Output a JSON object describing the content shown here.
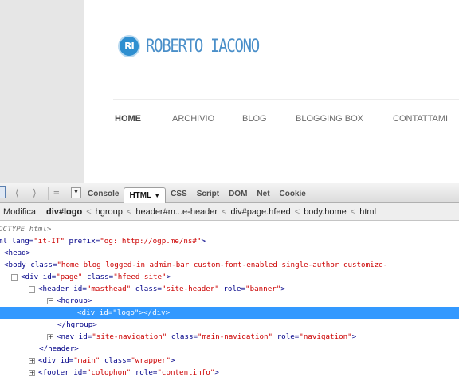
{
  "site": {
    "logo_mark": "RI",
    "logo_text": "ROBERTO IACONO",
    "nav": [
      "HOME",
      "ARCHIVIO",
      "BLOG",
      "BLOGGING BOX",
      "CONTATTAMI"
    ]
  },
  "toolbar": {
    "tabs": [
      "Console",
      "HTML",
      "CSS",
      "Script",
      "DOM",
      "Net",
      "Cookie"
    ],
    "active_caret": "▼"
  },
  "breadcrumb": {
    "edit": "Modifica",
    "items": [
      "div#logo",
      "hgroup",
      "header#m...e-header",
      "div#page.hfeed",
      "body.home",
      "html"
    ],
    "sep": "<"
  },
  "tree": {
    "r0": "OCTYPE html>",
    "r1a": "ml lang=",
    "r1b": "\"it-IT\"",
    "r1c": " prefix=",
    "r1d": "\"og: http://ogp.me/ns#\"",
    "r1e": ">",
    "r2": "<head>",
    "r3a": "<body class=",
    "r3b": "\"home blog logged-in admin-bar custom-font-enabled single-author customize-",
    "r4a": "<div id=",
    "r4b": "\"page\"",
    "r4c": " class=",
    "r4d": "\"hfeed site\"",
    "r4e": ">",
    "r5a": "<header id=",
    "r5b": "\"masthead\"",
    "r5c": " class=",
    "r5d": "\"site-header\"",
    "r5e": " role=",
    "r5f": "\"banner\"",
    "r5g": ">",
    "r6": "<hgroup>",
    "r7a": "<div id=",
    "r7b": "\"logo\"",
    "r7c": "></div>",
    "r8": "</hgroup>",
    "r9a": "<nav id=",
    "r9b": "\"site-navigation\"",
    "r9c": " class=",
    "r9d": "\"main-navigation\"",
    "r9e": " role=",
    "r9f": "\"navigation\"",
    "r9g": ">",
    "r10": "</header>",
    "r11a": "<div id=",
    "r11b": "\"main\"",
    "r11c": " class=",
    "r11d": "\"wrapper\"",
    "r11e": ">",
    "r12a": "<footer id=",
    "r12b": "\"colophon\"",
    "r12c": " role=",
    "r12d": "\"contentinfo\"",
    "r12e": ">"
  }
}
